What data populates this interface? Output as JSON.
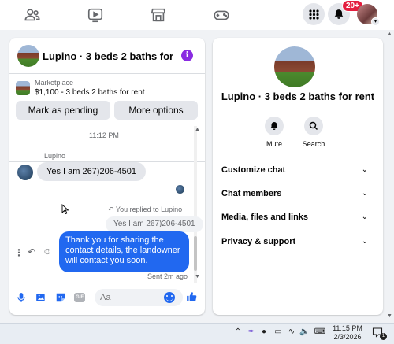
{
  "topnav": {
    "icons": [
      "friends-icon",
      "watch-icon",
      "marketplace-icon",
      "gaming-icon",
      "menu-grid-icon",
      "bell-icon"
    ],
    "notifications_badge": "20+",
    "accent": "#1877f2"
  },
  "chat": {
    "title": "Lupino · 3 beds 2 baths for r…",
    "marketplace": {
      "label": "Marketplace",
      "listing": "$1,100 - 3 beds 2 baths for rent",
      "mark_pending": "Mark as pending",
      "more_options": "More options"
    },
    "timestamp": "11:12 PM",
    "sender": "Lupino",
    "incoming_message": "Yes I am 267)206-4501",
    "replied_label": "You replied to Lupino",
    "quoted_message": "Yes I am 267)206-4501",
    "outgoing_message": "Thank you for sharing the contact details, the landowner will contact you soon.",
    "sent_status": "Sent 2m ago",
    "composer_placeholder": "Aa",
    "outgoing_color": "#2168f0"
  },
  "info_panel": {
    "title": "Lupino · 3 beds 2 baths for rent",
    "actions": [
      {
        "label": "Mute",
        "icon": "bell-icon"
      },
      {
        "label": "Search",
        "icon": "search-icon"
      }
    ],
    "sections": [
      {
        "label": "Customize chat"
      },
      {
        "label": "Chat members"
      },
      {
        "label": "Media, files and links"
      },
      {
        "label": "Privacy & support"
      }
    ]
  },
  "taskbar": {
    "time": "11:15 PM",
    "date": "2/3/2026",
    "notification_count": "1"
  }
}
